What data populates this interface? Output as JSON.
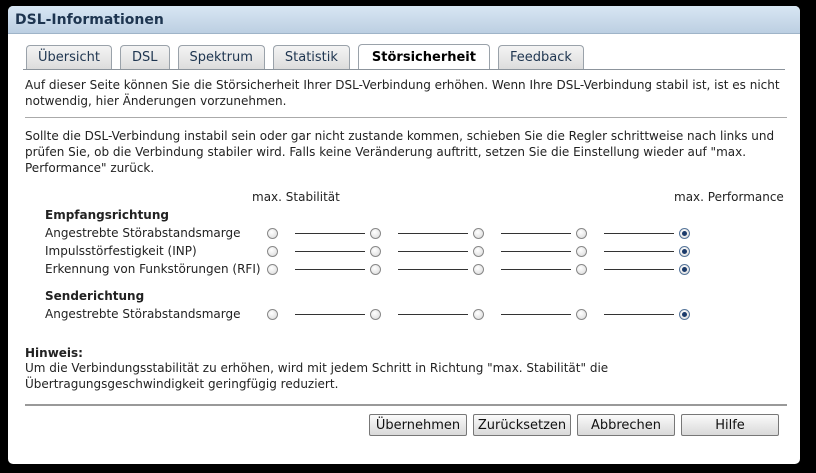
{
  "dialog": {
    "title": "DSL-Informationen"
  },
  "tabs": [
    {
      "label": "Übersicht",
      "active": false
    },
    {
      "label": "DSL",
      "active": false
    },
    {
      "label": "Spektrum",
      "active": false
    },
    {
      "label": "Statistik",
      "active": false
    },
    {
      "label": "Störsicherheit",
      "active": true
    },
    {
      "label": "Feedback",
      "active": false
    }
  ],
  "intro": "Auf dieser Seite können Sie die Störsicherheit Ihrer DSL-Verbindung erhöhen. Wenn Ihre DSL-Verbindung stabil ist, ist es nicht notwendig, hier Änderungen vorzunehmen.",
  "instructions": "Sollte die DSL-Verbindung instabil sein oder gar nicht zustande kommen, schieben Sie die Regler schrittweise nach links und prüfen Sie, ob die Verbindung stabiler wird. Falls keine Veränderung auftritt, setzen Sie die Einstellung wieder auf \"max. Performance\" zurück.",
  "scale": {
    "left_label": "max. Stabilität",
    "right_label": "max. Performance",
    "steps": 5
  },
  "groups": [
    {
      "title": "Empfangsrichtung",
      "rows": [
        {
          "label": "Angestrebte Störabstandsmarge",
          "selected_step": 5
        },
        {
          "label": "Impulsstörfestigkeit (INP)",
          "selected_step": 5
        },
        {
          "label": "Erkennung von Funkstörungen (RFI)",
          "selected_step": 5
        }
      ]
    },
    {
      "title": "Senderichtung",
      "rows": [
        {
          "label": "Angestrebte Störabstandsmarge",
          "selected_step": 5
        }
      ]
    }
  ],
  "hint": {
    "title": "Hinweis:",
    "text": "Um die Verbindungsstabilität zu erhöhen, wird mit jedem Schritt in Richtung \"max. Stabilität\" die Übertragungsgeschwindigkeit geringfügig reduziert."
  },
  "buttons": {
    "apply": "Übernehmen",
    "reset": "Zurücksetzen",
    "cancel": "Abbrechen",
    "help": "Hilfe"
  },
  "colors": {
    "title_bar": "#c9d9ea",
    "selected_radio": "#1a3a6a"
  }
}
